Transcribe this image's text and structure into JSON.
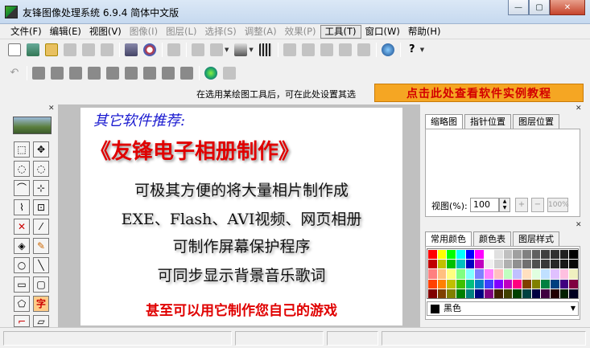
{
  "window": {
    "title": "友锋图像处理系统 6.9.4 简体中文版",
    "buttons": {
      "minimize": "—",
      "maximize": "▢",
      "close": "✕"
    }
  },
  "menu": [
    {
      "label": "文件(F)",
      "enabled": true
    },
    {
      "label": "编辑(E)",
      "enabled": true
    },
    {
      "label": "视图(V)",
      "enabled": true
    },
    {
      "label": "图像(I)",
      "enabled": false
    },
    {
      "label": "图层(L)",
      "enabled": false
    },
    {
      "label": "选择(S)",
      "enabled": false
    },
    {
      "label": "调整(A)",
      "enabled": false
    },
    {
      "label": "效果(P)",
      "enabled": false
    },
    {
      "label": "工具(T)",
      "enabled": true,
      "active": true
    },
    {
      "label": "窗口(W)",
      "enabled": true
    },
    {
      "label": "帮助(H)",
      "enabled": true
    }
  ],
  "hint_bar": {
    "text": "在选用某绘图工具后，可在此处设置其选",
    "promo": "点击此处查看软件实例教程"
  },
  "ad": {
    "heading": "其它软件推荐:",
    "title": "《友锋电子相册制作》",
    "lines": [
      "可极其方便的将大量相片制作成",
      "EXE、Flash、AVI视频、网页相册",
      "可制作屏幕保护程序",
      "可同步显示背景音乐歌词"
    ],
    "footer": "甚至可以用它制作您自己的游戏"
  },
  "navigator_panel": {
    "tabs": [
      "缩略图",
      "指针位置",
      "图层位置"
    ],
    "zoom_label": "视图(%):",
    "zoom_value": "100",
    "zoom_in": "+",
    "zoom_out": "−",
    "zoom_reset": "100%"
  },
  "color_panel": {
    "tabs": [
      "常用颜色",
      "颜色表",
      "图层样式"
    ],
    "selected_color": "黑色",
    "selected_hex": "#000000",
    "swatches": [
      "#ff0000",
      "#ffff00",
      "#00ff00",
      "#00ffff",
      "#0000ff",
      "#ff00ff",
      "#ffffff",
      "#e0e0e0",
      "#c0c0c0",
      "#a0a0a0",
      "#808080",
      "#606060",
      "#404040",
      "#303030",
      "#202020",
      "#000000",
      "#c00000",
      "#c0c000",
      "#00c000",
      "#00c0c0",
      "#0000c0",
      "#c000c0",
      "#f0f0f0",
      "#d0d0d0",
      "#b0b0b0",
      "#909090",
      "#707070",
      "#505050",
      "#383838",
      "#282828",
      "#181818",
      "#080808",
      "#ff8080",
      "#ffc080",
      "#ffff80",
      "#80ff80",
      "#80ffff",
      "#8080ff",
      "#ff80ff",
      "#ffc0c0",
      "#c0ffc0",
      "#c0c0ff",
      "#ffe0c0",
      "#e0ffe0",
      "#c0e0ff",
      "#e0c0ff",
      "#ffc0e0",
      "#f0f0c0",
      "#ff4000",
      "#ff8000",
      "#c0c000",
      "#40c000",
      "#00c080",
      "#0080c0",
      "#4040ff",
      "#8000ff",
      "#c000c0",
      "#ff0080",
      "#804000",
      "#808000",
      "#008040",
      "#004080",
      "#400080",
      "#800040",
      "#800000",
      "#804000",
      "#808000",
      "#008000",
      "#008080",
      "#000080",
      "#800080",
      "#402000",
      "#404000",
      "#004000",
      "#004040",
      "#000040",
      "#400040",
      "#200000",
      "#002000",
      "#000020"
    ]
  },
  "tools": [
    "rect-select-icon",
    "move-icon",
    "ellipse-select-icon",
    "magic-ellipse-icon",
    "lasso-icon",
    "crop-icon",
    "polygon-lasso-icon",
    "transform-icon",
    "resize-icon",
    "magic-wand-icon",
    "fill-icon",
    "pencil-icon",
    "ellipse-icon",
    "line-icon",
    "rectangle-icon",
    "rounded-rect-icon",
    "polygon-icon",
    "text-icon",
    "brush-icon",
    "eraser-icon"
  ]
}
